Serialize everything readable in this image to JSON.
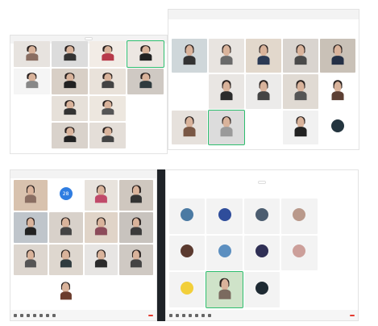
{
  "panel1": {
    "banner": "",
    "tiles": [
      {
        "name": ""
      },
      {
        "name": ""
      },
      {
        "name": ""
      },
      {
        "name": ""
      },
      {
        "name": ""
      },
      {
        "name": ""
      },
      {
        "name": ""
      },
      {
        "name": ""
      },
      {
        "name": ""
      },
      {
        "name": ""
      },
      {
        "name": ""
      },
      {
        "name": ""
      },
      {
        "name": ""
      },
      {
        "name": ""
      },
      {
        "name": ""
      },
      {
        "name": ""
      }
    ]
  },
  "panel2": {
    "status": "",
    "tiles": [
      {
        "name": ""
      },
      {
        "name": ""
      },
      {
        "name": ""
      },
      {
        "name": ""
      },
      {
        "name": ""
      },
      {
        "name": ""
      },
      {
        "name": ""
      },
      {
        "name": ""
      },
      {
        "name": ""
      },
      {
        "name": ""
      },
      {
        "name": ""
      },
      {
        "name": ""
      }
    ]
  },
  "panel3": {
    "avatar_number": "28",
    "tiles": [
      {
        "name": ""
      },
      {
        "name": ""
      },
      {
        "name": ""
      },
      {
        "name": ""
      },
      {
        "name": ""
      },
      {
        "name": ""
      },
      {
        "name": ""
      },
      {
        "name": ""
      },
      {
        "name": ""
      },
      {
        "name": ""
      },
      {
        "name": ""
      },
      {
        "name": ""
      },
      {
        "name": ""
      }
    ]
  },
  "panel4": {
    "banner": "",
    "tiles": [
      {
        "name": ""
      },
      {
        "name": ""
      },
      {
        "name": ""
      },
      {
        "name": ""
      },
      {
        "name": ""
      },
      {
        "name": ""
      },
      {
        "name": ""
      },
      {
        "name": ""
      },
      {
        "name": ""
      },
      {
        "name": ""
      },
      {
        "name": ""
      }
    ]
  },
  "colors": {
    "active_speaker": "#2dbd6e",
    "leave": "#e53b30",
    "avatar_blue": "#2f7de1"
  }
}
